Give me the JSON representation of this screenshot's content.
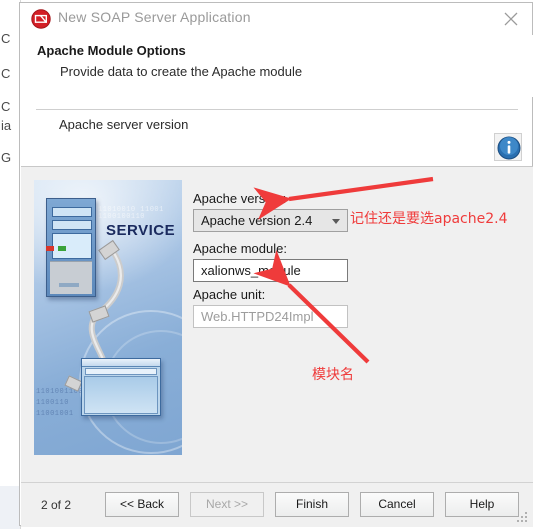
{
  "background_window": {
    "edge_letters": [
      "C",
      "C",
      "C",
      "ia",
      "G"
    ]
  },
  "dialog": {
    "title": "New SOAP Server Application",
    "app_icon": "dx-logo-icon",
    "close_icon": "close-icon",
    "header": {
      "title": "Apache Module Options",
      "subtitle": "Provide data to create the Apache module",
      "section_label": "Apache server version",
      "info_icon": "info-icon"
    },
    "banner": {
      "word": "SERVICE",
      "binary_rows": [
        "11010010 11001",
        "1100100110",
        "11010011001",
        "1100110",
        "11001001"
      ]
    },
    "form": {
      "version": {
        "label": "Apache version:",
        "value": "Apache version 2.4",
        "caret_icon": "chevron-down-icon"
      },
      "module": {
        "label": "Apache module:",
        "value": "xalionws_module"
      },
      "unit": {
        "label": "Apache unit:",
        "value": "Web.HTTPD24Impl"
      }
    },
    "annotations": {
      "color": "#ef3b3b",
      "version_note": "记住还是要选apache2.4",
      "module_note": "模块名"
    },
    "footer": {
      "step": "2 of 2",
      "back": "<< Back",
      "next": "Next >>",
      "finish": "Finish",
      "cancel": "Cancel",
      "help": "Help",
      "grip_icon": "resize-grip-icon"
    }
  }
}
